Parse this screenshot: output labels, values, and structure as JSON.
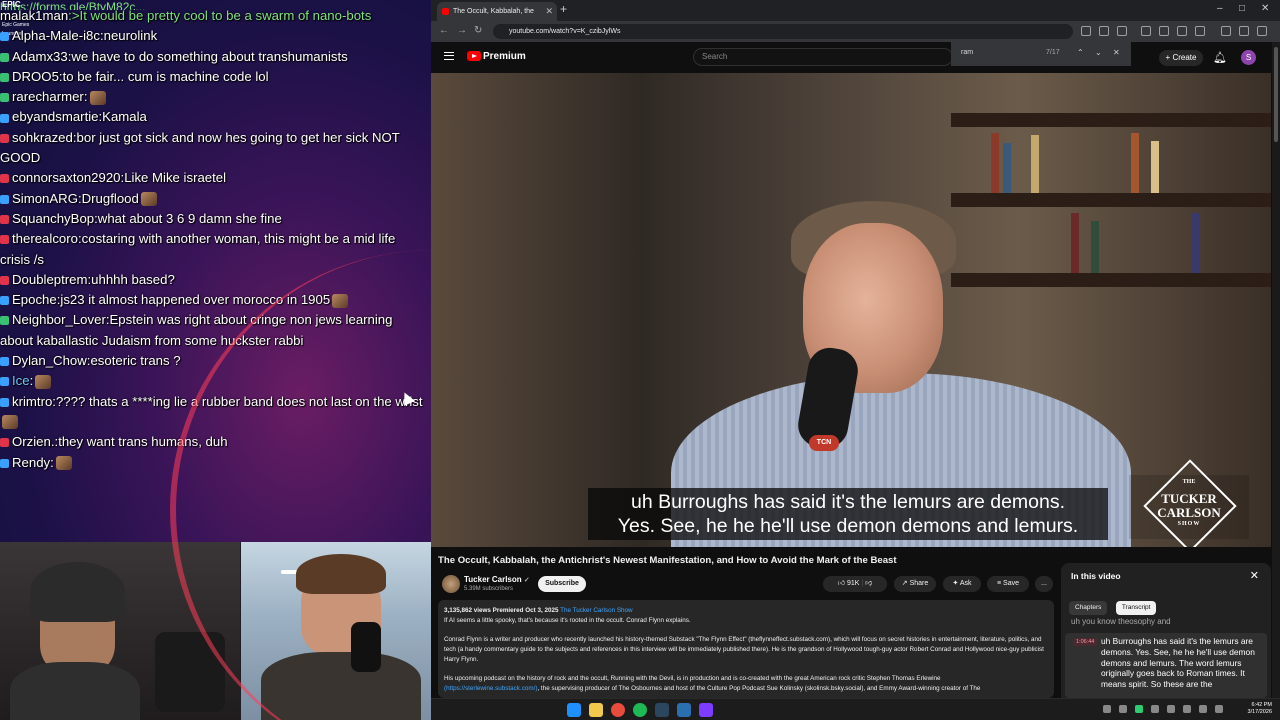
{
  "stream": {
    "top_url": "https://forms.gle/BtyM82c...",
    "epic_label": "EPIC",
    "epic_sub": "Epic Games",
    "epic_sub2": "Launcher",
    "chat": [
      {
        "user": "malak1man",
        "text": ">It would be pretty cool to be a swarm of nano-bots",
        "color": "#7fe07f",
        "badge": "",
        "green": true
      },
      {
        "user": "Alpha-Male-i8c",
        "text": "neurolink",
        "badge": "#3aa0ff"
      },
      {
        "user": "Adamx33",
        "text": "we have to do something about transhumanists",
        "badge": "#38c172"
      },
      {
        "user": "DROO5",
        "text": "to be fair... cum is machine code lol",
        "badge": "#38c172"
      },
      {
        "user": "rarecharmer",
        "text": "",
        "badge": "#38c172",
        "emote": true
      },
      {
        "user": "ebyandsmartie",
        "text": "Kamala",
        "badge": "#3aa0ff"
      },
      {
        "user": "sohkrazed",
        "text": "bor just got sick and now hes going to get her sick NOT GOOD",
        "badge": "#e0344a"
      },
      {
        "user": "connorsaxton2920",
        "text": "Like Mike israetel",
        "badge": "#e0344a"
      },
      {
        "user": "SimonARG",
        "text": "Drugflood",
        "badge": "#3aa0ff",
        "emote": true
      },
      {
        "user": "SquanchyBop",
        "text": "what about 3 6 9 damn she fine",
        "badge": "#e0344a"
      },
      {
        "user": "therealcoro",
        "text": "costaring with another woman, this might be a mid life crisis /s",
        "badge": "#e0344a"
      },
      {
        "user": "Doubleptrem",
        "text": "uhhhh based?",
        "badge": "#e0344a"
      },
      {
        "user": "Epoche",
        "text": "js23 it almost happened over morocco in 1905",
        "badge": "#3aa0ff",
        "emote": true
      },
      {
        "user": "Neighbor_Lover",
        "text": "Epstein was right about cringe non jews learning about kaballastic Judaism from some huckster rabbi",
        "badge": "#38c172"
      },
      {
        "user": "Dylan_Chow",
        "text": "esoteric trans ?",
        "badge": "#3aa0ff"
      },
      {
        "user": "Ice",
        "text": "",
        "badge": "#3aa0ff",
        "emote": true,
        "ucolor": "#6fc3ff"
      },
      {
        "user": "krimtro",
        "text": "???? thats a ****ing lie a rubber band does not last on the wrist",
        "badge": "#3aa0ff",
        "emote": true
      },
      {
        "user": "Orzien.",
        "text": "they want trans humans, duh",
        "badge": "#e0344a"
      },
      {
        "user": "Rendy",
        "text": "",
        "badge": "#3aa0ff",
        "emote": true
      }
    ]
  },
  "browser": {
    "tab_title": "The Occult, Kabbalah, the",
    "url": "youtube.com/watch?v=K_czibJylWs",
    "yt_brand": "Premium",
    "search_placeholder": "Search",
    "find_query": "ram",
    "find_count": "7/17",
    "create_label": "Create",
    "avatar_letter": "S"
  },
  "video": {
    "caption_line1": "uh Burroughs has said it's the lemurs are demons.",
    "caption_line2": "Yes. See, he he he'll use demon demons and lemurs.",
    "mic_badge": "TCN",
    "logo_l1": "THE",
    "logo_l2": "TUCKER",
    "logo_l3": "CARLSON",
    "logo_l4": "SHOW",
    "title": "The Occult, Kabbalah, the Antichrist's Newest Manifestation, and How to Avoid the Mark of the Beast",
    "channel": "Tucker Carlson",
    "subscribers": "5.39M subscribers",
    "subscribe_label": "Subscribe",
    "likes": "91K",
    "share_label": "Share",
    "ask_label": "Ask",
    "save_label": "Save",
    "more_label": "...",
    "desc_meta": "3,135,862 views  Premiered Oct 3, 2025",
    "desc_meta_link": "The Tucker Carlson Show",
    "desc_p1": "If AI seems a little spooky, that's because it's rooted in the occult. Conrad Flynn explains.",
    "desc_p2": "Conrad Flynn is a writer and producer who recently launched his history-themed Substack \"The Flynn Effect\" (theflynneffect.substack.com), which will focus on secret histories in entertainment, literature, politics, and tech (a handy commentary guide to the subjects and references in this interview will be immediately published there). He is the grandson of Hollywood tough-guy actor Robert Conrad and Hollywood nice-guy publicist Harry Flynn.",
    "desc_p3": "His upcoming podcast on the history of rock and the occult, Running with the Devil, is in production and is co-created with the great American rock critic Stephen Thomas Erlewine",
    "desc_p4_link": "(https://sterlewine.substack.com/)",
    "desc_p4": ", the supervising producer of The Osbournes and host of the Culture Pop Podcast Sue Kolinsky (skolinsk.bsky.social), and Emmy Award-winning creator of The"
  },
  "panel": {
    "title": "In this video",
    "tab_chapters": "Chapters",
    "tab_transcript": "Transcript",
    "prev_line": "uh you know theosophy and",
    "timestamp": "1:06:44",
    "segment_text": "uh Burroughs has said it's the lemurs are demons.  Yes. See, he he he'll use demon demons and lemurs.   The word lemurs originally goes back to Roman times. It means spirit. So these are the"
  },
  "taskbar": {
    "time": "6:42 PM",
    "date": "3/17/2026"
  }
}
